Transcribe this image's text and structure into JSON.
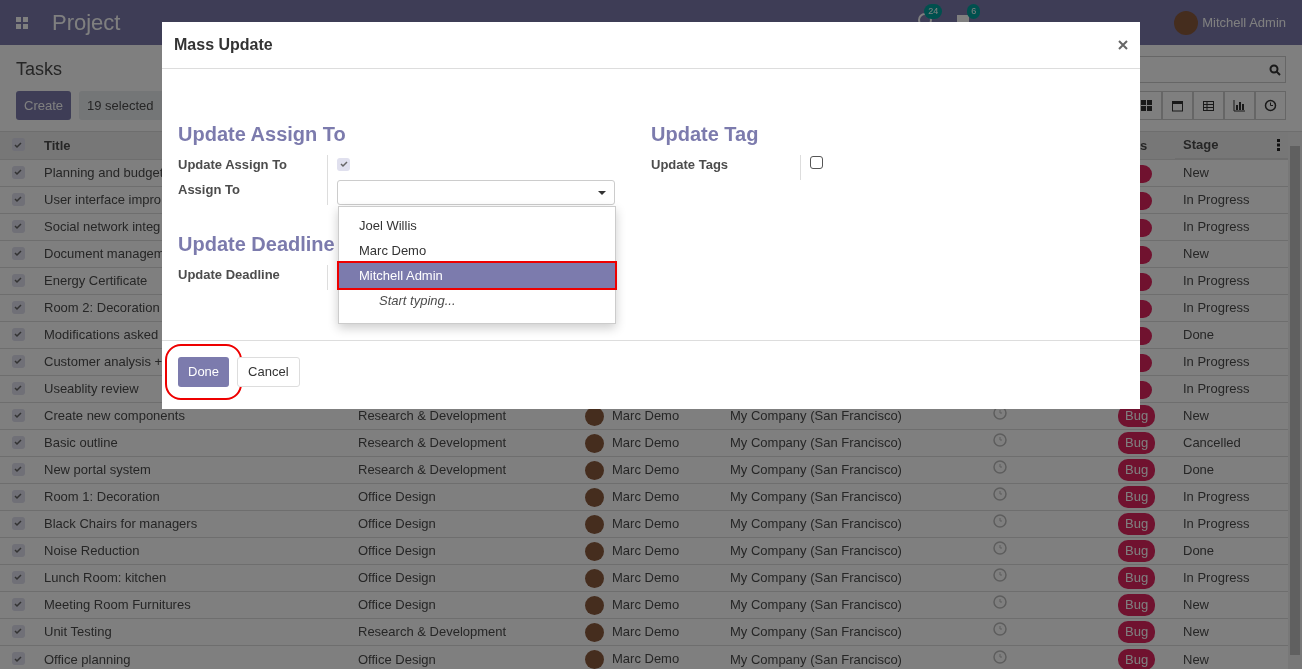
{
  "navbar": {
    "app_title": "Project",
    "activity_count": "24",
    "message_count": "6",
    "user": "Mitchell Admin"
  },
  "control_panel": {
    "breadcrumb": "Tasks",
    "create_button": "Create",
    "selection": "19 selected",
    "views": [
      {
        "kind": "kanban"
      },
      {
        "kind": "calendar"
      },
      {
        "kind": "list"
      },
      {
        "kind": "graph"
      },
      {
        "kind": "activity"
      }
    ]
  },
  "table": {
    "all_checked": true,
    "columns": [
      {
        "label": "Title"
      },
      {
        "label": "s"
      },
      {
        "label": "Stage"
      }
    ],
    "rows": [
      {
        "kind": "covered",
        "checked": true,
        "title": "Planning and budget",
        "stage": "New"
      },
      {
        "kind": "covered",
        "checked": true,
        "title": "User interface impro",
        "stage": "In Progress"
      },
      {
        "kind": "covered",
        "checked": true,
        "title": "Social network integ",
        "stage": "In Progress"
      },
      {
        "kind": "covered",
        "checked": true,
        "title": "Document managem",
        "stage": "New"
      },
      {
        "kind": "covered",
        "checked": true,
        "title": "Energy Certificate",
        "stage": "In Progress"
      },
      {
        "kind": "covered",
        "checked": true,
        "title": "Room 2: Decoration",
        "stage": "In Progress"
      },
      {
        "kind": "covered",
        "checked": true,
        "title": "Modifications asked",
        "stage": "Done"
      },
      {
        "kind": "covered",
        "checked": true,
        "title": "Customer analysis +",
        "stage": "In Progress"
      },
      {
        "kind": "covered",
        "checked": true,
        "title": "Useablity review",
        "stage": "In Progress"
      },
      {
        "kind": "full",
        "checked": true,
        "title": "Create new components",
        "project": "Research & Development",
        "assignee": "Marc Demo",
        "company": "My Company (San Francisco)",
        "tag": "Bug",
        "stage": "New"
      },
      {
        "kind": "full",
        "checked": true,
        "title": "Basic outline",
        "project": "Research & Development",
        "assignee": "Marc Demo",
        "company": "My Company (San Francisco)",
        "tag": "Bug",
        "stage": "Cancelled"
      },
      {
        "kind": "full",
        "checked": true,
        "title": "New portal system",
        "project": "Research & Development",
        "assignee": "Marc Demo",
        "company": "My Company (San Francisco)",
        "tag": "Bug",
        "stage": "Done"
      },
      {
        "kind": "full",
        "checked": true,
        "title": "Room 1: Decoration",
        "project": "Office Design",
        "assignee": "Marc Demo",
        "company": "My Company (San Francisco)",
        "tag": "Bug",
        "stage": "In Progress"
      },
      {
        "kind": "full",
        "checked": true,
        "title": "Black Chairs for managers",
        "project": "Office Design",
        "assignee": "Marc Demo",
        "company": "My Company (San Francisco)",
        "tag": "Bug",
        "stage": "In Progress"
      },
      {
        "kind": "full",
        "checked": true,
        "title": "Noise Reduction",
        "project": "Office Design",
        "assignee": "Marc Demo",
        "company": "My Company (San Francisco)",
        "tag": "Bug",
        "stage": "Done"
      },
      {
        "kind": "full",
        "checked": true,
        "title": "Lunch Room: kitchen",
        "project": "Office Design",
        "assignee": "Marc Demo",
        "company": "My Company (San Francisco)",
        "tag": "Bug",
        "stage": "In Progress"
      },
      {
        "kind": "full",
        "checked": true,
        "title": "Meeting Room Furnitures",
        "project": "Office Design",
        "assignee": "Marc Demo",
        "company": "My Company (San Francisco)",
        "tag": "Bug",
        "stage": "New"
      },
      {
        "kind": "full",
        "checked": true,
        "title": "Unit Testing",
        "project": "Research & Development",
        "assignee": "Marc Demo",
        "company": "My Company (San Francisco)",
        "tag": "Bug",
        "stage": "New"
      },
      {
        "kind": "full",
        "checked": true,
        "title": "Office planning",
        "project": "Office Design",
        "assignee": "Marc Demo",
        "company": "My Company (San Francisco)",
        "tag": "Bug",
        "stage": "New"
      }
    ]
  },
  "modal": {
    "title": "Mass Update",
    "columns": [
      [
        {
          "heading": "Update Assign To",
          "fields": [
            {
              "kind": "checkbox",
              "label": "Update Assign To",
              "checked": true
            },
            {
              "kind": "select",
              "label": "Assign To",
              "options": [
                {
                  "label": "Joel Willis",
                  "selected": false,
                  "highlighted": false
                },
                {
                  "label": "Marc Demo",
                  "selected": false,
                  "highlighted": false
                },
                {
                  "label": "Mitchell Admin",
                  "selected": true,
                  "highlighted": true
                }
              ],
              "hint": "Start typing..."
            }
          ]
        },
        {
          "heading": "Update Deadline",
          "fields": [
            {
              "kind": "label",
              "label": "Update Deadline"
            }
          ]
        }
      ],
      [
        {
          "heading": "Update Tag",
          "fields": [
            {
              "kind": "checkbox",
              "label": "Update Tags",
              "checked": false
            }
          ]
        }
      ]
    ],
    "buttons": [
      {
        "label": "Done",
        "kind": "primary",
        "highlighted": true
      },
      {
        "label": "Cancel",
        "kind": "secondary",
        "highlighted": false
      }
    ]
  }
}
